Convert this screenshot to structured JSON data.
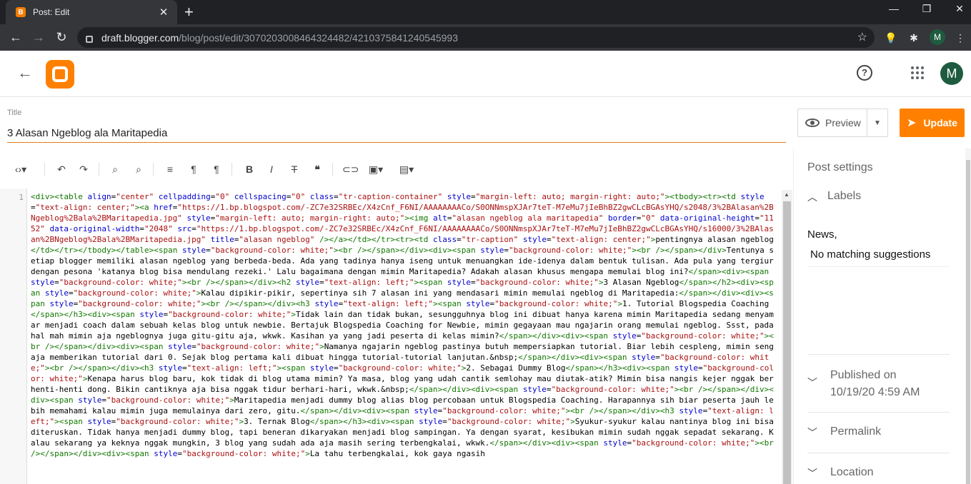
{
  "browser": {
    "tab_title": "Post: Edit",
    "tab_favicon": "B",
    "new_tab": "+",
    "url_host": "draft.blogger.com",
    "url_path": "/blog/post/edit/3070203008464324482/4210375841240545993",
    "profile_initial": "M"
  },
  "header": {
    "avatar_initial": "M"
  },
  "post": {
    "title_label": "Title",
    "title_value": "3 Alasan Ngeblog ala Maritapedia"
  },
  "actions": {
    "preview_label": "Preview",
    "update_label": "Update"
  },
  "editor": {
    "line_number": "1",
    "code": "<div><table align=\"center\" cellpadding=\"0\" cellspacing=\"0\" class=\"tr-caption-container\" style=\"margin-left: auto; margin-right: auto;\"><tbody><tr><td style=\"text-align: center;\"><a href=\"https://1.bp.blogspot.com/-ZC7e32SRBEc/X4zCnf_F6NI/AAAAAAAACo/S0ONNmspXJAr7teT-M7eMu7jIeBhBZ2gwCLcBGAsYHQ/s2048/3%2BAlasan%2BNgeblog%2Bala%2BMaritapedia.jpg\" style=\"margin-left: auto; margin-right: auto;\"><img alt=\"alasan ngeblog ala maritapedia\" border=\"0\" data-original-height=\"1152\" data-original-width=\"2048\" src=\"https://1.bp.blogspot.com/-ZC7e32SRBEc/X4zCnf_F6NI/AAAAAAAACo/S0ONNmspXJAr7teT-M7eMu7jIeBhBZ2gwCLcBGAsYHQ/s16000/3%2BAlasan%2BNgeblog%2Bala%2BMaritapedia.jpg\" title=\"alasan ngeblog\" /></a></td></tr><tr><td class=\"tr-caption\" style=\"text-align: center;\">pentingnya alasan ngeblog</td></tr></tbody></table><span style=\"background-color: white;\"><br /></span></div><div><span style=\"background-color: white;\"><br /></span></div>Tentunya setiap blogger memiliki alasan ngeblog yang berbeda-beda. Ada yang tadinya hanya iseng untuk menuangkan ide-idenya dalam bentuk tulisan. Ada pula yang tergiur dengan pesona 'katanya blog bisa mendulang rezeki.' Lalu bagaimana dengan mimin Maritapedia? Adakah alasan khusus mengapa memulai blog ini?</span><div><span style=\"background-color: white;\"><br /></span></div><h2 style=\"text-align: left;\"><span style=\"background-color: white;\">3 Alasan Ngeblog</span></h2><div><span style=\"background-color: white;\">Kalau dipikir-pikir, sepertinya sih 7 alasan ini yang mendasari mimin memulai ngeblog di Maritapedia:</span></div><div><span style=\"background-color: white;\"><br /></span></div><h3 style=\"text-align: left;\"><span style=\"background-color: white;\">1. Tutorial Blogspedia Coaching</span></h3><div><span style=\"background-color: white;\">Tidak lain dan tidak bukan, sesungguhnya blog ini dibuat hanya karena mimin Maritapedia sedang menyamar menjadi coach dalam sebuah kelas blog untuk newbie. Bertajuk Blogspedia Coaching for Newbie, mimin gegayaan mau ngajarin orang memulai ngeblog. Ssst, padahal mah mimin aja ngeblognya juga gitu-gitu aja, wkwk. Kasihan ya yang jadi peserta di kelas mimin?</span></div><div><span style=\"background-color: white;\"><br /></span></div><div><span style=\"background-color: white;\">Namanya ngajarin ngeblog pastinya butuh mempersiapkan tutorial. Biar lebih cespleng, mimin sengaja memberikan tutorial dari 0. Sejak blog pertama kali dibuat hingga tutorial-tutorial lanjutan.&nbsp;</span></div><div><span style=\"background-color: white;\"><br /></span></div><h3 style=\"text-align: left;\"><span style=\"background-color: white;\">2. Sebagai Dummy Blog</span></h3><div><span style=\"background-color: white;\">Kenapa harus blog baru, kok tidak di blog utama mimin? Ya masa, blog yang udah cantik semlohay mau diutak-atik? Mimin bisa nangis kejer nggak berhenti-henti dong. Bikin cantiknya aja bisa nggak tidur berhari-hari, wkwk.&nbsp;</span></div><div><span style=\"background-color: white;\"><br /></span></div><div><span style=\"background-color: white;\">Maritapedia menjadi dummy blog alias blog percobaan untuk Blogspedia Coaching. Harapannya sih biar peserta jauh lebih memahami kalau mimin juga memulainya dari zero, gitu.</span></div><div><span style=\"background-color: white;\"><br /></span></div><h3 style=\"text-align: left;\"><span style=\"background-color: white;\">3. Ternak Blog</span></h3><div><span style=\"background-color: white;\">Syukur-syukur kalau nantinya blog ini bisa diteruskan. Tidak hanya menjadi dummy blog, tapi beneran dikaryakan menjadi blog sampingan. Ya dengan syarat, kesibukan mimin sudah nggak sepadat sekarang. Kalau sekarang ya keknya nggak mungkin, 3 blog yang sudah ada aja masih sering terbengkalai, wkwk.</span></div><div><span style=\"background-color: white;\"><br /></span></div><div><span style=\"background-color: white;\">La tahu terbengkalai, kok gaya ngasih"
  },
  "sidebar": {
    "title": "Post settings",
    "labels_heading": "Labels",
    "labels_value": "News,",
    "no_suggestions": "No matching suggestions",
    "published_label": "Published on",
    "published_date": "10/19/20 4:59 AM",
    "permalink_label": "Permalink",
    "location_label": "Location"
  },
  "colors": {
    "accent": "#ff8000",
    "chrome_dark": "#202124",
    "chrome_mid": "#35363a"
  }
}
